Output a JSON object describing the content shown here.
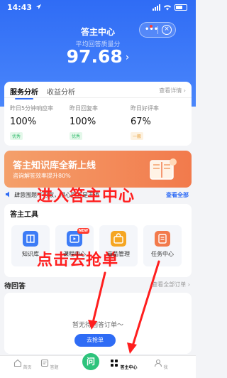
{
  "status_bar": {
    "time": "14:43"
  },
  "header": {
    "title": "答主中心",
    "score_label": "平均回答质量分",
    "score": "97.68",
    "score_chevron": "›"
  },
  "service": {
    "tabs": [
      {
        "label": "服务分析"
      },
      {
        "label": "收益分析"
      }
    ],
    "detail_link": "查看详情 ›",
    "metrics": [
      {
        "label": "昨日5分钟响应率",
        "value": "100%",
        "tag": "优秀"
      },
      {
        "label": "昨日回复率",
        "value": "100%",
        "tag": "优秀"
      },
      {
        "label": "昨日好评率",
        "value": "67%",
        "tag": "一般"
      }
    ]
  },
  "banner": {
    "title": "答主知识库全新上线",
    "subtitle": "咨询解答效率提升80%"
  },
  "notice": {
    "text": "肆意围题不可取，用心回答是王道",
    "link": "查看全部"
  },
  "tools": {
    "heading": "答主工具",
    "items": [
      {
        "label": "知识库",
        "icon": "book-icon"
      },
      {
        "label": "课程中心",
        "icon": "course-icon",
        "badge": "NEW"
      },
      {
        "label": "商品管理",
        "icon": "bag-icon"
      },
      {
        "label": "任务中心",
        "icon": "task-icon"
      }
    ]
  },
  "pending": {
    "title": "待回答",
    "more": "查看全部订单 ›",
    "empty_text": "暂无待回答订单～",
    "grab_button": "去抢单"
  },
  "tabbar": {
    "items": [
      {
        "label": "首页"
      },
      {
        "label": "答题"
      },
      {
        "label": "答主中心"
      },
      {
        "label": "我"
      }
    ],
    "fab_label": "问"
  },
  "annotations": {
    "enter_center": "进入答主中心",
    "click_grab": "点击去抢单"
  },
  "colors": {
    "primary": "#2f6cf5",
    "annotation": "#ff1e1e",
    "good": "#2fb96a",
    "normal": "#e69a2d",
    "fab": "#2ec37c"
  }
}
